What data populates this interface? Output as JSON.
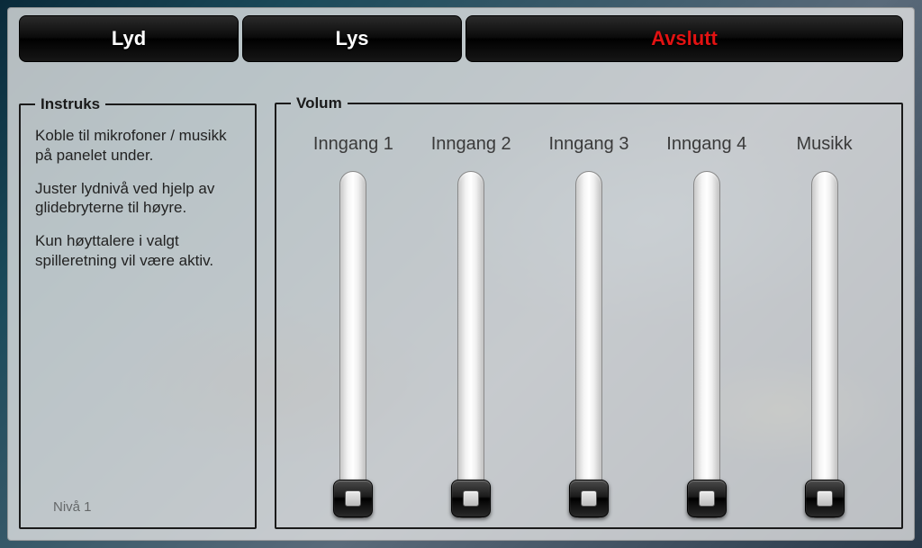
{
  "tabs": {
    "sound": "Lyd",
    "light": "Lys",
    "exit": "Avslutt"
  },
  "instruks": {
    "legend": "Instruks",
    "p1": "Koble til mikrofoner / musikk på panelet under.",
    "p2": "Juster lydnivå ved hjelp av glidebryterne til høyre.",
    "p3": "Kun høyttalere i valgt spilleretning vil være aktiv.",
    "level": "Nivå 1"
  },
  "volum": {
    "legend": "Volum",
    "sliders": [
      {
        "label": "Inngang 1",
        "value": 0
      },
      {
        "label": "Inngang 2",
        "value": 0
      },
      {
        "label": "Inngang 3",
        "value": 0
      },
      {
        "label": "Inngang 4",
        "value": 0
      },
      {
        "label": "Musikk",
        "value": 0
      }
    ]
  },
  "colors": {
    "exit": "#e11212"
  }
}
